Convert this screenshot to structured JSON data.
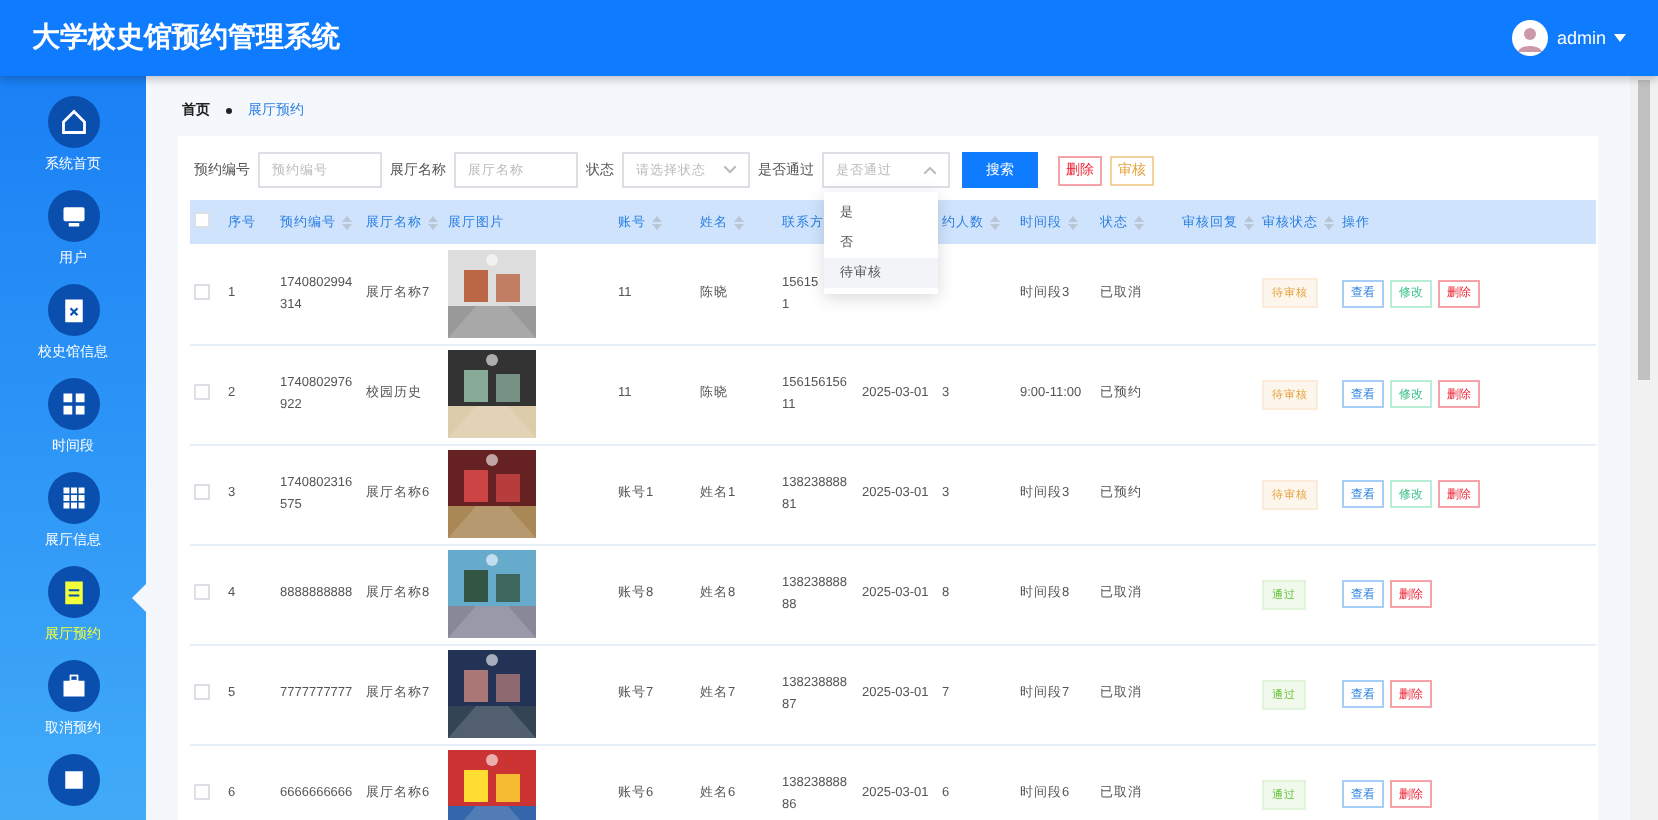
{
  "header": {
    "title": "大学校史馆预约管理系统",
    "user": "admin"
  },
  "sidebar": {
    "items": [
      {
        "label": "系统首页",
        "selected": false
      },
      {
        "label": "用户",
        "selected": false
      },
      {
        "label": "校史馆信息",
        "selected": false
      },
      {
        "label": "时间段",
        "selected": false
      },
      {
        "label": "展厅信息",
        "selected": false
      },
      {
        "label": "展厅预约",
        "selected": true
      },
      {
        "label": "取消预约",
        "selected": false
      },
      {
        "selected": false
      }
    ]
  },
  "breadcrumb": [
    "首页",
    "展厅预约"
  ],
  "filters": [
    {
      "label": "预约编号",
      "kind": "input",
      "placeholder": "预约编号"
    },
    {
      "label": "展厅名称",
      "kind": "input",
      "placeholder": "展厅名称"
    },
    {
      "label": "状态",
      "kind": "select",
      "placeholder": "请选择状态",
      "open": false
    },
    {
      "label": "是否通过",
      "kind": "select",
      "placeholder": "是否通过",
      "open": true,
      "options": [
        {
          "label": "是",
          "highlighted": false
        },
        {
          "label": "否",
          "highlighted": false
        },
        {
          "label": "待审核",
          "highlighted": true
        }
      ]
    }
  ],
  "buttons": [
    {
      "label": "搜索",
      "kind": "primary"
    },
    {
      "label": "删除",
      "kind": "danger"
    },
    {
      "label": "审核",
      "kind": "warning"
    }
  ],
  "table": {
    "all_checked": false,
    "columns": [
      {
        "label": "序号",
        "sortable": false
      },
      {
        "label": "预约编号",
        "sortable": true
      },
      {
        "label": "展厅名称",
        "sortable": true
      },
      {
        "label": "展厅图片",
        "sortable": false
      },
      {
        "label": "账号",
        "sortable": true
      },
      {
        "label": "姓名",
        "sortable": true
      },
      {
        "label": "联系方",
        "sortable": false
      },
      {
        "label": "约人数",
        "sortable": true
      },
      {
        "label": "时间段",
        "sortable": true
      },
      {
        "label": "状态",
        "sortable": true
      },
      {
        "label": "审核回复",
        "sortable": true
      },
      {
        "label": "审核状态",
        "sortable": true
      },
      {
        "label": "操作",
        "sortable": false
      }
    ],
    "rows": [
      {
        "checked": false,
        "no": "1",
        "code": "1740802994314",
        "hall": "展厅名称7",
        "account": "11",
        "name": "陈晓",
        "phone": "15615\n1",
        "slot": "时间段3",
        "status": "已取消",
        "review": {
          "label": "待审核",
          "kind": "pending"
        },
        "actions": [
          {
            "label": "查看",
            "kind": "view"
          },
          {
            "label": "修改",
            "kind": "edit"
          },
          {
            "label": "删除",
            "kind": "delete"
          }
        ]
      },
      {
        "checked": false,
        "no": "2",
        "code": "1740802976922",
        "hall": "校园历史",
        "account": "11",
        "name": "陈晓",
        "phone": "15615615611",
        "date": "2025-03-01",
        "people": "3",
        "slot": "9:00-11:00",
        "status": "已预约",
        "review": {
          "label": "待审核",
          "kind": "pending"
        },
        "actions": [
          {
            "label": "查看",
            "kind": "view"
          },
          {
            "label": "修改",
            "kind": "edit"
          },
          {
            "label": "删除",
            "kind": "delete"
          }
        ]
      },
      {
        "checked": false,
        "no": "3",
        "code": "1740802316575",
        "hall": "展厅名称6",
        "account": "账号1",
        "name": "姓名1",
        "phone": "13823888881",
        "date": "2025-03-01",
        "people": "3",
        "slot": "时间段3",
        "status": "已预约",
        "review": {
          "label": "待审核",
          "kind": "pending"
        },
        "actions": [
          {
            "label": "查看",
            "kind": "view"
          },
          {
            "label": "修改",
            "kind": "edit"
          },
          {
            "label": "删除",
            "kind": "delete"
          }
        ]
      },
      {
        "checked": false,
        "no": "4",
        "code": "8888888888",
        "hall": "展厅名称8",
        "account": "账号8",
        "name": "姓名8",
        "phone": "13823888888",
        "date": "2025-03-01",
        "people": "8",
        "slot": "时间段8",
        "status": "已取消",
        "review": {
          "label": "通过",
          "kind": "passed"
        },
        "actions": [
          {
            "label": "查看",
            "kind": "view"
          },
          {
            "label": "删除",
            "kind": "delete"
          }
        ]
      },
      {
        "checked": false,
        "no": "5",
        "code": "7777777777",
        "hall": "展厅名称7",
        "account": "账号7",
        "name": "姓名7",
        "phone": "13823888887",
        "date": "2025-03-01",
        "people": "7",
        "slot": "时间段7",
        "status": "已取消",
        "review": {
          "label": "通过",
          "kind": "passed"
        },
        "actions": [
          {
            "label": "查看",
            "kind": "view"
          },
          {
            "label": "删除",
            "kind": "delete"
          }
        ]
      },
      {
        "checked": false,
        "no": "6",
        "code": "6666666666",
        "hall": "展厅名称6",
        "account": "账号6",
        "name": "姓名6",
        "phone": "13823888886",
        "date": "2025-03-01",
        "people": "6",
        "slot": "时间段6",
        "status": "已取消",
        "review": {
          "label": "通过",
          "kind": "passed"
        },
        "actions": [
          {
            "label": "查看",
            "kind": "view"
          },
          {
            "label": "删除",
            "kind": "delete"
          }
        ]
      }
    ]
  }
}
